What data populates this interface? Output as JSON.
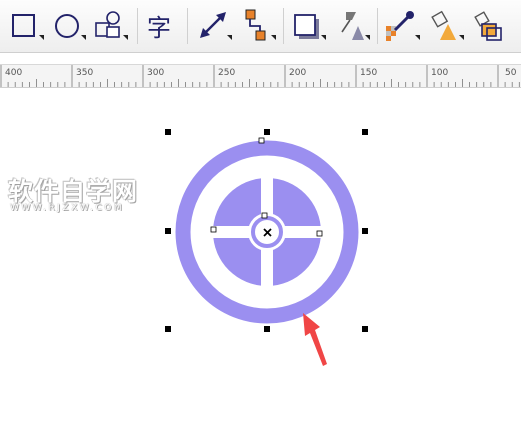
{
  "toolbar": {
    "tools": [
      {
        "name": "rectangle-tool"
      },
      {
        "name": "ellipse-tool"
      },
      {
        "name": "basic-shapes-tool"
      },
      {
        "name": "text-tool",
        "glyph": "字"
      },
      {
        "name": "dimension-tool"
      },
      {
        "name": "connector-tool"
      },
      {
        "name": "drop-shadow-tool"
      },
      {
        "name": "transparency-tool"
      },
      {
        "name": "color-eyedropper-tool"
      },
      {
        "name": "interactive-fill-tool"
      },
      {
        "name": "smart-fill-tool"
      }
    ]
  },
  "ruler": {
    "labels": [
      "400",
      "350",
      "300",
      "250",
      "200",
      "150",
      "100",
      "50"
    ]
  },
  "watermark": {
    "main": "软件自学网",
    "sub": "WWW.RJZXW.COM"
  },
  "colors": {
    "shape_fill": "#9b8ff0",
    "arrow": "#f04646",
    "handle": "#000000",
    "toolbar_blue": "#23236a",
    "toolbar_orange": "#e8822a"
  }
}
